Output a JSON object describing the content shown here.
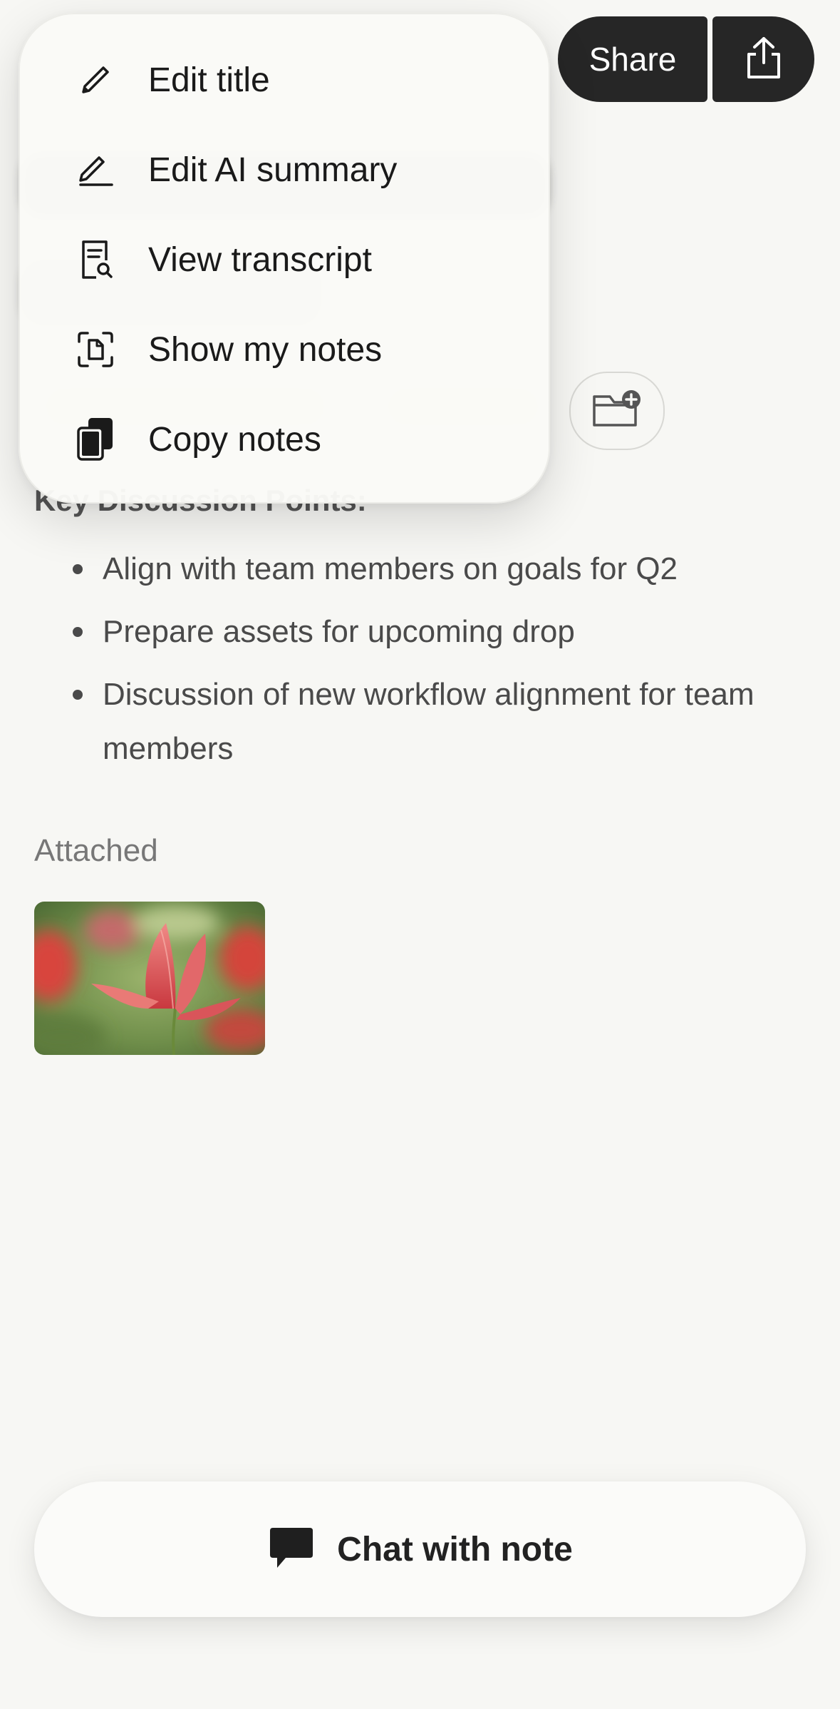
{
  "header": {
    "share_label": "Share"
  },
  "menu": {
    "items": [
      {
        "label": "Edit title",
        "icon": "pencil-icon"
      },
      {
        "label": "Edit AI summary",
        "icon": "edit-line-icon"
      },
      {
        "label": "View transcript",
        "icon": "transcript-search-icon"
      },
      {
        "label": "Show my notes",
        "icon": "scan-document-icon"
      },
      {
        "label": "Copy notes",
        "icon": "copy-icon"
      }
    ]
  },
  "note": {
    "section_heading": "Key Discussion Points:",
    "points": [
      "Align with team members on goals for Q2",
      "Prepare assets for upcoming drop",
      "Discussion of new workflow alignment for team members"
    ],
    "attached_label": "Attached",
    "attachment_icon": "tulip-photo"
  },
  "chat": {
    "label": "Chat with note",
    "icon": "chat-bubble-icon"
  },
  "colors": {
    "background": "#f7f7f4",
    "dark_button": "#262626",
    "text": "#1a1a1a",
    "muted_text": "#4a4a4a"
  }
}
